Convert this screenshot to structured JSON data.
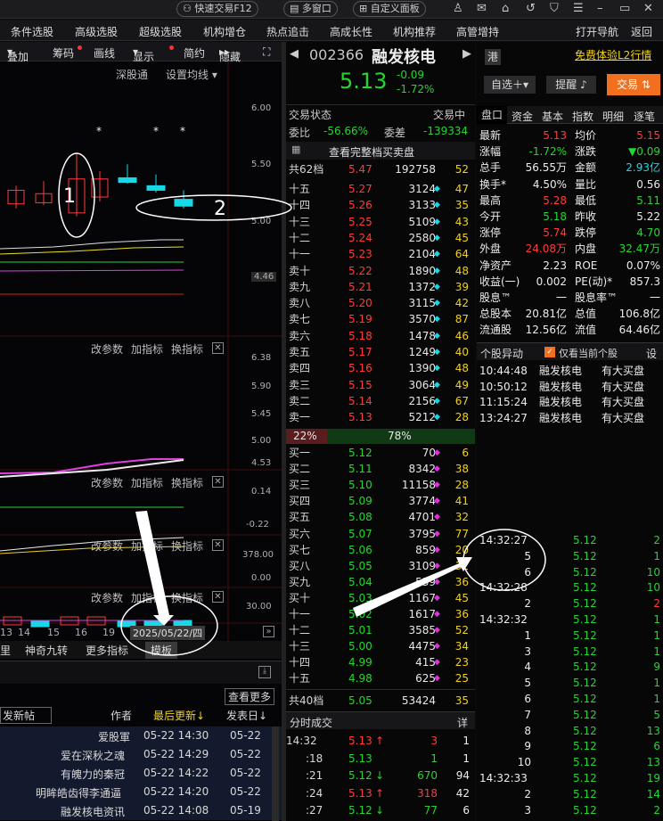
{
  "topbar": {
    "quick_trade": "快速交易F12",
    "multi_window": "多窗口",
    "custom_panel": "自定义面板",
    "icons": [
      "user-icon",
      "mail-icon",
      "home-icon",
      "back-icon",
      "shirt-icon",
      "menu-icon",
      "minimize-icon",
      "restore-icon",
      "close-icon"
    ]
  },
  "menu": {
    "items": [
      "条件选股",
      "高级选股",
      "超级选股",
      "机构增仓",
      "热点追击",
      "高成长性",
      "机构推荐",
      "高管增持"
    ],
    "nav": "打开导航",
    "back": "返回"
  },
  "chart_toolbar": {
    "overlay": "叠加",
    "chips": "筹码",
    "draw": "画线",
    "display": "显示",
    "compact": "简约",
    "hide": "隐藏"
  },
  "chart": {
    "exchange": "深股通",
    "set_ma": "设置均线",
    "price_axis": [
      "6.00",
      "5.50",
      "5.00",
      "4.46"
    ],
    "candles": [
      {
        "o": 5.16,
        "c": 5.28,
        "h": 5.32,
        "l": 5.12,
        "t": "up"
      },
      {
        "o": 5.17,
        "c": 5.25,
        "h": 5.36,
        "l": 5.15,
        "t": "up"
      },
      {
        "o": 5.28,
        "c": 5.36,
        "h": 5.42,
        "l": 5.2,
        "t": "doji"
      },
      {
        "o": 5.38,
        "c": 5.08,
        "h": 5.6,
        "l": 5.05,
        "t": "down-hollow"
      },
      {
        "o": 5.22,
        "c": 5.38,
        "h": 5.45,
        "l": 5.18,
        "t": "up"
      },
      {
        "o": 5.35,
        "c": 5.39,
        "h": 5.51,
        "l": 5.34,
        "t": "cyan"
      },
      {
        "o": 5.28,
        "c": 5.32,
        "h": 5.42,
        "l": 5.26,
        "t": "cyan"
      },
      {
        "o": 5.14,
        "c": 5.2,
        "h": 5.28,
        "l": 5.12,
        "t": "cyan"
      }
    ],
    "stars": [
      "*",
      "*",
      "*"
    ]
  },
  "sub1": {
    "params": "改参数",
    "add": "加指标",
    "switch": "换指标",
    "axis": [
      "6.38",
      "5.90",
      "5.45",
      "5.00",
      "4.53"
    ]
  },
  "sub2": {
    "params": "改参数",
    "add": "加指标",
    "switch": "换指标",
    "axis": [
      "0.14",
      "-0.22"
    ]
  },
  "sub3": {
    "params": "改参数",
    "add": "加指标",
    "switch": "换指标",
    "axis": [
      "378.00",
      "0.00"
    ]
  },
  "sub4": {
    "params": "改参数",
    "add": "加指标",
    "switch": "换指标",
    "axis": [
      "30.00"
    ]
  },
  "xaxis": {
    "ticks": [
      "13",
      "14",
      "15",
      "16",
      "19"
    ],
    "date": "2025/05/22/四"
  },
  "bottom_tabs": {
    "t1": "里",
    "t2": "神奇九转",
    "t3": "更多指标",
    "t4": "模板"
  },
  "forum": {
    "more": "查看更多",
    "new_post": "发新帖",
    "col_author": "作者",
    "col_latest": "最后更新↓",
    "col_date": "发表日↓",
    "rows": [
      {
        "author": "爱股軍",
        "latest": "05-22 14:30",
        "date": "05-22"
      },
      {
        "author": "爱在深秋之魂",
        "latest": "05-22 14:29",
        "date": "05-22"
      },
      {
        "author": "有魄力的秦冠",
        "latest": "05-22 14:22",
        "date": "05-22"
      },
      {
        "author": "明眸皓齿得李通逼",
        "latest": "05-22 14:20",
        "date": "05-22"
      },
      {
        "author": "融发核电资讯",
        "latest": "05-22 14:08",
        "date": "05-19"
      }
    ]
  },
  "stock": {
    "code": "002366",
    "name": "融发核电",
    "price": "5.13",
    "change": "-0.09",
    "pct": "-1.72%",
    "gang": "港",
    "l2": "免费体验L2行情",
    "watch": "自选＋",
    "remind": "提醒",
    "trade": "交易"
  },
  "orderbook": {
    "status": "交易状态",
    "trading": "交易中",
    "ratio_label": "委比",
    "ratio": "-56.66%",
    "diff_label": "委差",
    "diff": "-139334",
    "view_all": "查看完整档买卖盘",
    "ask_total": {
      "label": "共62档",
      "price": "5.47",
      "vol": "192758",
      "cnt": "52"
    },
    "asks": [
      {
        "l": "十五",
        "p": "5.27",
        "v": "3124",
        "c": "47"
      },
      {
        "l": "十四",
        "p": "5.26",
        "v": "3133",
        "c": "35"
      },
      {
        "l": "十三",
        "p": "5.25",
        "v": "5109",
        "c": "43"
      },
      {
        "l": "十二",
        "p": "5.24",
        "v": "2580",
        "c": "45"
      },
      {
        "l": "十一",
        "p": "5.23",
        "v": "2104",
        "c": "64"
      },
      {
        "l": "卖十",
        "p": "5.22",
        "v": "1890",
        "c": "48"
      },
      {
        "l": "卖九",
        "p": "5.21",
        "v": "1372",
        "c": "39"
      },
      {
        "l": "卖八",
        "p": "5.20",
        "v": "3115",
        "c": "42"
      },
      {
        "l": "卖七",
        "p": "5.19",
        "v": "3570",
        "c": "87"
      },
      {
        "l": "卖六",
        "p": "5.18",
        "v": "1478",
        "c": "46"
      },
      {
        "l": "卖五",
        "p": "5.17",
        "v": "1249",
        "c": "40"
      },
      {
        "l": "卖四",
        "p": "5.16",
        "v": "1390",
        "c": "48"
      },
      {
        "l": "卖三",
        "p": "5.15",
        "v": "3064",
        "c": "49"
      },
      {
        "l": "卖二",
        "p": "5.14",
        "v": "2156",
        "c": "67"
      },
      {
        "l": "卖一",
        "p": "5.13",
        "v": "5212",
        "c": "28"
      }
    ],
    "bar": {
      "sell": "22%",
      "buy": "78%"
    },
    "bids": [
      {
        "l": "买一",
        "p": "5.12",
        "v": "70",
        "c": "6"
      },
      {
        "l": "买二",
        "p": "5.11",
        "v": "8342",
        "c": "38"
      },
      {
        "l": "买三",
        "p": "5.10",
        "v": "11158",
        "c": "28"
      },
      {
        "l": "买四",
        "p": "5.09",
        "v": "3774",
        "c": "41"
      },
      {
        "l": "买五",
        "p": "5.08",
        "v": "4701",
        "c": "32"
      },
      {
        "l": "买六",
        "p": "5.07",
        "v": "3795",
        "c": "77"
      },
      {
        "l": "买七",
        "p": "5.06",
        "v": "859",
        "c": "20"
      },
      {
        "l": "买八",
        "p": "5.05",
        "v": "3109",
        "c": "32"
      },
      {
        "l": "买九",
        "p": "5.04",
        "v": "539",
        "c": "36"
      },
      {
        "l": "买十",
        "p": "5.03",
        "v": "1167",
        "c": "45"
      },
      {
        "l": "十一",
        "p": "5.02",
        "v": "1617",
        "c": "36"
      },
      {
        "l": "十二",
        "p": "5.01",
        "v": "3585",
        "c": "52"
      },
      {
        "l": "十三",
        "p": "5.00",
        "v": "4475",
        "c": "34"
      },
      {
        "l": "十四",
        "p": "4.99",
        "v": "415",
        "c": "23"
      },
      {
        "l": "十五",
        "p": "4.98",
        "v": "625",
        "c": "25"
      }
    ],
    "bid_total": {
      "label": "共40档",
      "price": "5.05",
      "vol": "53424",
      "cnt": "35"
    },
    "ticks_title": "分时成交",
    "ticks_detail": "详",
    "ticks": [
      {
        "t": "14:32",
        "p": "5.13",
        "a": "↑",
        "v": "3",
        "n": "1"
      },
      {
        "t": ":18",
        "p": "5.13",
        "a": "",
        "v": "1",
        "n": "1"
      },
      {
        "t": ":21",
        "p": "5.12",
        "a": "↓",
        "v": "670",
        "n": "94"
      },
      {
        "t": ":24",
        "p": "5.13",
        "a": "↑",
        "v": "318",
        "n": "42"
      },
      {
        "t": ":27",
        "p": "5.12",
        "a": "↓",
        "v": "77",
        "n": "6"
      }
    ]
  },
  "quote": {
    "tabs": [
      "盘口",
      "资金",
      "基本",
      "指数",
      "明细",
      "逐笔"
    ],
    "rows": [
      [
        "最新",
        "5.13",
        "均价",
        "5.15"
      ],
      [
        "涨幅",
        "-1.72%",
        "涨跌",
        "▼0.09"
      ],
      [
        "总手",
        "56.55万",
        "金额",
        "2.93亿"
      ],
      [
        "换手*",
        "4.50%",
        "量比",
        "0.56"
      ],
      [
        "最高",
        "5.28",
        "最低",
        "5.11"
      ],
      [
        "今开",
        "5.18",
        "昨收",
        "5.22"
      ],
      [
        "涨停",
        "5.74",
        "跌停",
        "4.70"
      ],
      [
        "外盘",
        "24.08万",
        "内盘",
        "32.47万"
      ],
      [
        "净资产",
        "2.23",
        "ROE",
        "0.07%"
      ],
      [
        "收益(一)",
        "0.002",
        "PE(动)*",
        "857.3"
      ],
      [
        "股息™",
        "一",
        "股息率™",
        "一"
      ],
      [
        "总股本",
        "20.81亿",
        "总值",
        "106.8亿"
      ],
      [
        "流通股",
        "12.56亿",
        "流值",
        "64.46亿"
      ]
    ],
    "colors": [
      [
        "w",
        "r",
        "w",
        "r"
      ],
      [
        "w",
        "g",
        "w",
        "g"
      ],
      [
        "w",
        "w",
        "w",
        "c"
      ],
      [
        "w",
        "w",
        "w",
        "w"
      ],
      [
        "w",
        "r",
        "w",
        "g"
      ],
      [
        "w",
        "g",
        "w",
        "w"
      ],
      [
        "w",
        "r",
        "w",
        "g"
      ],
      [
        "w",
        "r",
        "w",
        "g"
      ],
      [
        "w",
        "w",
        "w",
        "w"
      ],
      [
        "w",
        "w",
        "w",
        "w"
      ],
      [
        "w",
        "w",
        "w",
        "w"
      ],
      [
        "w",
        "w",
        "w",
        "w"
      ],
      [
        "w",
        "w",
        "w",
        "w"
      ]
    ]
  },
  "alerts": {
    "title": "个股异动",
    "only_current": "仅看当前个股",
    "settings": "设",
    "rows": [
      {
        "t": "10:44:48",
        "name": "融发核电",
        "ev": "有大买盘"
      },
      {
        "t": "10:50:12",
        "name": "融发核电",
        "ev": "有大买盘"
      },
      {
        "t": "11:15:24",
        "name": "融发核电",
        "ev": "有大买盘"
      },
      {
        "t": "13:24:27",
        "name": "融发核电",
        "ev": "有大买盘"
      }
    ]
  },
  "trades": [
    {
      "t": "14:32:27",
      "p": "5.12",
      "v": "2",
      "vc": "g"
    },
    {
      "t": "5",
      "p": "5.12",
      "v": "1",
      "vc": "g"
    },
    {
      "t": "6",
      "p": "5.12",
      "v": "10",
      "vc": "g"
    },
    {
      "t": "14:32:28",
      "p": "5.12",
      "v": "10",
      "vc": "g"
    },
    {
      "t": "2",
      "p": "5.12",
      "v": "2",
      "vc": "r"
    },
    {
      "t": "14:32:32",
      "p": "5.12",
      "v": "1",
      "vc": "g"
    },
    {
      "t": "1",
      "p": "5.12",
      "v": "1",
      "vc": "g"
    },
    {
      "t": "3",
      "p": "5.12",
      "v": "1",
      "vc": "g"
    },
    {
      "t": "4",
      "p": "5.12",
      "v": "9",
      "vc": "g"
    },
    {
      "t": "5",
      "p": "5.12",
      "v": "1",
      "vc": "g"
    },
    {
      "t": "6",
      "p": "5.12",
      "v": "1",
      "vc": "g"
    },
    {
      "t": "7",
      "p": "5.12",
      "v": "5",
      "vc": "g"
    },
    {
      "t": "8",
      "p": "5.12",
      "v": "13",
      "vc": "g"
    },
    {
      "t": "9",
      "p": "5.12",
      "v": "6",
      "vc": "g"
    },
    {
      "t": "10",
      "p": "5.12",
      "v": "13",
      "vc": "g"
    },
    {
      "t": "14:32:33",
      "p": "5.12",
      "v": "19",
      "vc": "g"
    },
    {
      "t": "2",
      "p": "5.12",
      "v": "14",
      "vc": "g"
    },
    {
      "t": "3",
      "p": "5.12",
      "v": "2",
      "vc": "g"
    }
  ],
  "annotations": {
    "label1": "1",
    "label2": "2"
  }
}
